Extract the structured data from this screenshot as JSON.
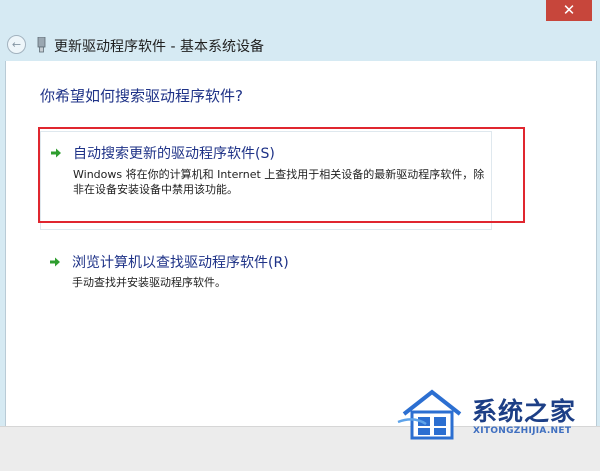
{
  "window": {
    "title": "更新驱动程序软件 - 基本系统设备",
    "close_glyph": "✕",
    "back_glyph": "←"
  },
  "main": {
    "question": "你希望如何搜索驱动程序软件?",
    "options": [
      {
        "title": "自动搜索更新的驱动程序软件(S)",
        "description": "Windows 将在你的计算机和 Internet 上查找用于相关设备的最新驱动程序软件，除非在设备安装设备中禁用该功能。",
        "icon": "green-arrow-icon"
      },
      {
        "title": "浏览计算机以查找驱动程序软件(R)",
        "description": "手动查找并安装驱动程序软件。",
        "icon": "green-arrow-icon"
      }
    ]
  },
  "watermark": {
    "brand": "系统之家",
    "url": "XITONGZHIJIA.NET"
  },
  "colors": {
    "link_blue": "#1e3287",
    "highlight_red": "#e0262f",
    "arrow_green": "#2f9e2f",
    "title_bar": "#d6eaf3",
    "close_red": "#c7463b"
  }
}
